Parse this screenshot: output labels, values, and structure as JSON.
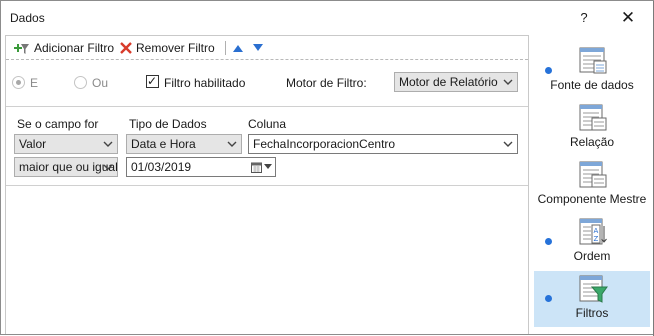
{
  "window": {
    "title": "Dados",
    "help_label": "?",
    "close_label": "✕"
  },
  "toolbar": {
    "add_filter_label": "Adicionar Filtro",
    "remove_filter_label": "Remover Filtro"
  },
  "options": {
    "and_label": "E",
    "or_label": "Ou",
    "filter_enabled_label": "Filtro habilitado",
    "filter_enabled_checked": true,
    "engine_label": "Motor de Filtro:",
    "engine_value": "Motor de Relatório"
  },
  "filter": {
    "field_header": "Se o campo for",
    "datatype_header": "Tipo de Dados",
    "column_header": "Coluna",
    "field_value": "Valor",
    "datatype_value": "Data e Hora",
    "column_value": "FechaIncorporacionCentro",
    "operator_value": "maior que ou igual",
    "date_value": "01/03/2019"
  },
  "sidebar": {
    "items": [
      {
        "label": "Fonte de dados",
        "has_dot": true,
        "icon": "datasource-icon"
      },
      {
        "label": "Relação",
        "has_dot": false,
        "icon": "relation-icon"
      },
      {
        "label": "Componente Mestre",
        "has_dot": false,
        "icon": "master-component-icon"
      },
      {
        "label": "Ordem",
        "has_dot": true,
        "icon": "sort-icon"
      },
      {
        "label": "Filtros",
        "has_dot": true,
        "icon": "filter-icon",
        "selected": true
      }
    ]
  },
  "colors": {
    "accent": "#2672d9",
    "selected_bg": "#cce4f7",
    "remove_red": "#d83b2b"
  }
}
